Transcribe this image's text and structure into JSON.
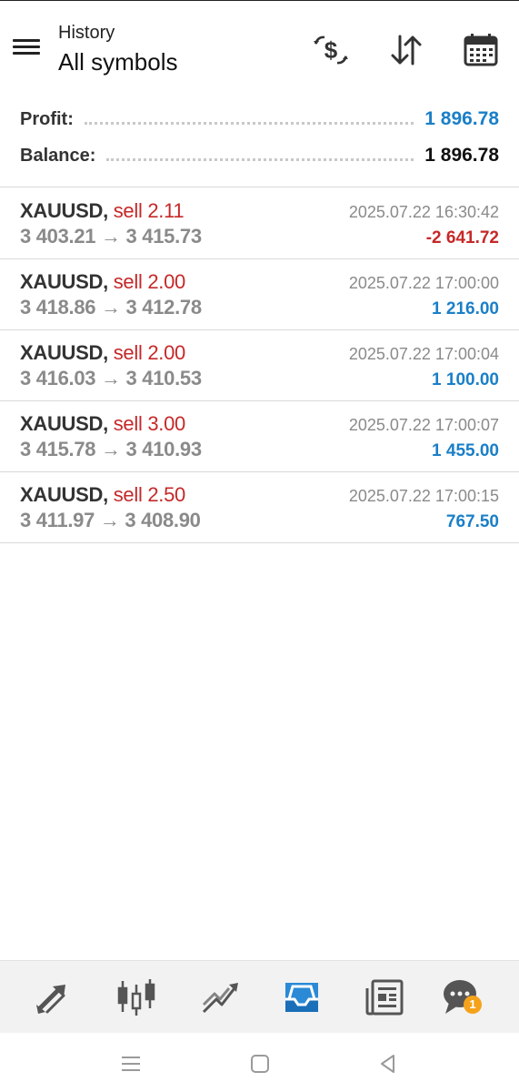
{
  "header": {
    "subtitle": "History",
    "title": "All symbols"
  },
  "summary": {
    "profit_label": "Profit:",
    "profit_value": "1 896.78",
    "balance_label": "Balance:",
    "balance_value": "1 896.78"
  },
  "deals": [
    {
      "symbol": "XAUUSD,",
      "side": "sell 2.11",
      "prices": "3 403.21 → 3 415.73",
      "time": "2025.07.22 16:30:42",
      "profit": "-2 641.72"
    },
    {
      "symbol": "XAUUSD,",
      "side": "sell 2.00",
      "prices": "3 418.86 → 3 412.78",
      "time": "2025.07.22 17:00:00",
      "profit": "1 216.00"
    },
    {
      "symbol": "XAUUSD,",
      "side": "sell 2.00",
      "prices": "3 416.03 → 3 410.53",
      "time": "2025.07.22 17:00:04",
      "profit": "1 100.00"
    },
    {
      "symbol": "XAUUSD,",
      "side": "sell 3.00",
      "prices": "3 415.78 → 3 410.93",
      "time": "2025.07.22 17:00:07",
      "profit": "1 455.00"
    },
    {
      "symbol": "XAUUSD,",
      "side": "sell 2.50",
      "prices": "3 411.97 → 3 408.90",
      "time": "2025.07.22 17:00:15",
      "profit": "767.50"
    }
  ],
  "bottom_nav": {
    "items": [
      "quotes-icon",
      "chart-icon",
      "trade-icon",
      "history-icon",
      "news-icon",
      "messages-icon"
    ],
    "active": "history-icon",
    "badge": "1"
  },
  "colors": {
    "accent": "#1a7fc7",
    "negative": "#c62828",
    "badge": "#f5a21b"
  }
}
